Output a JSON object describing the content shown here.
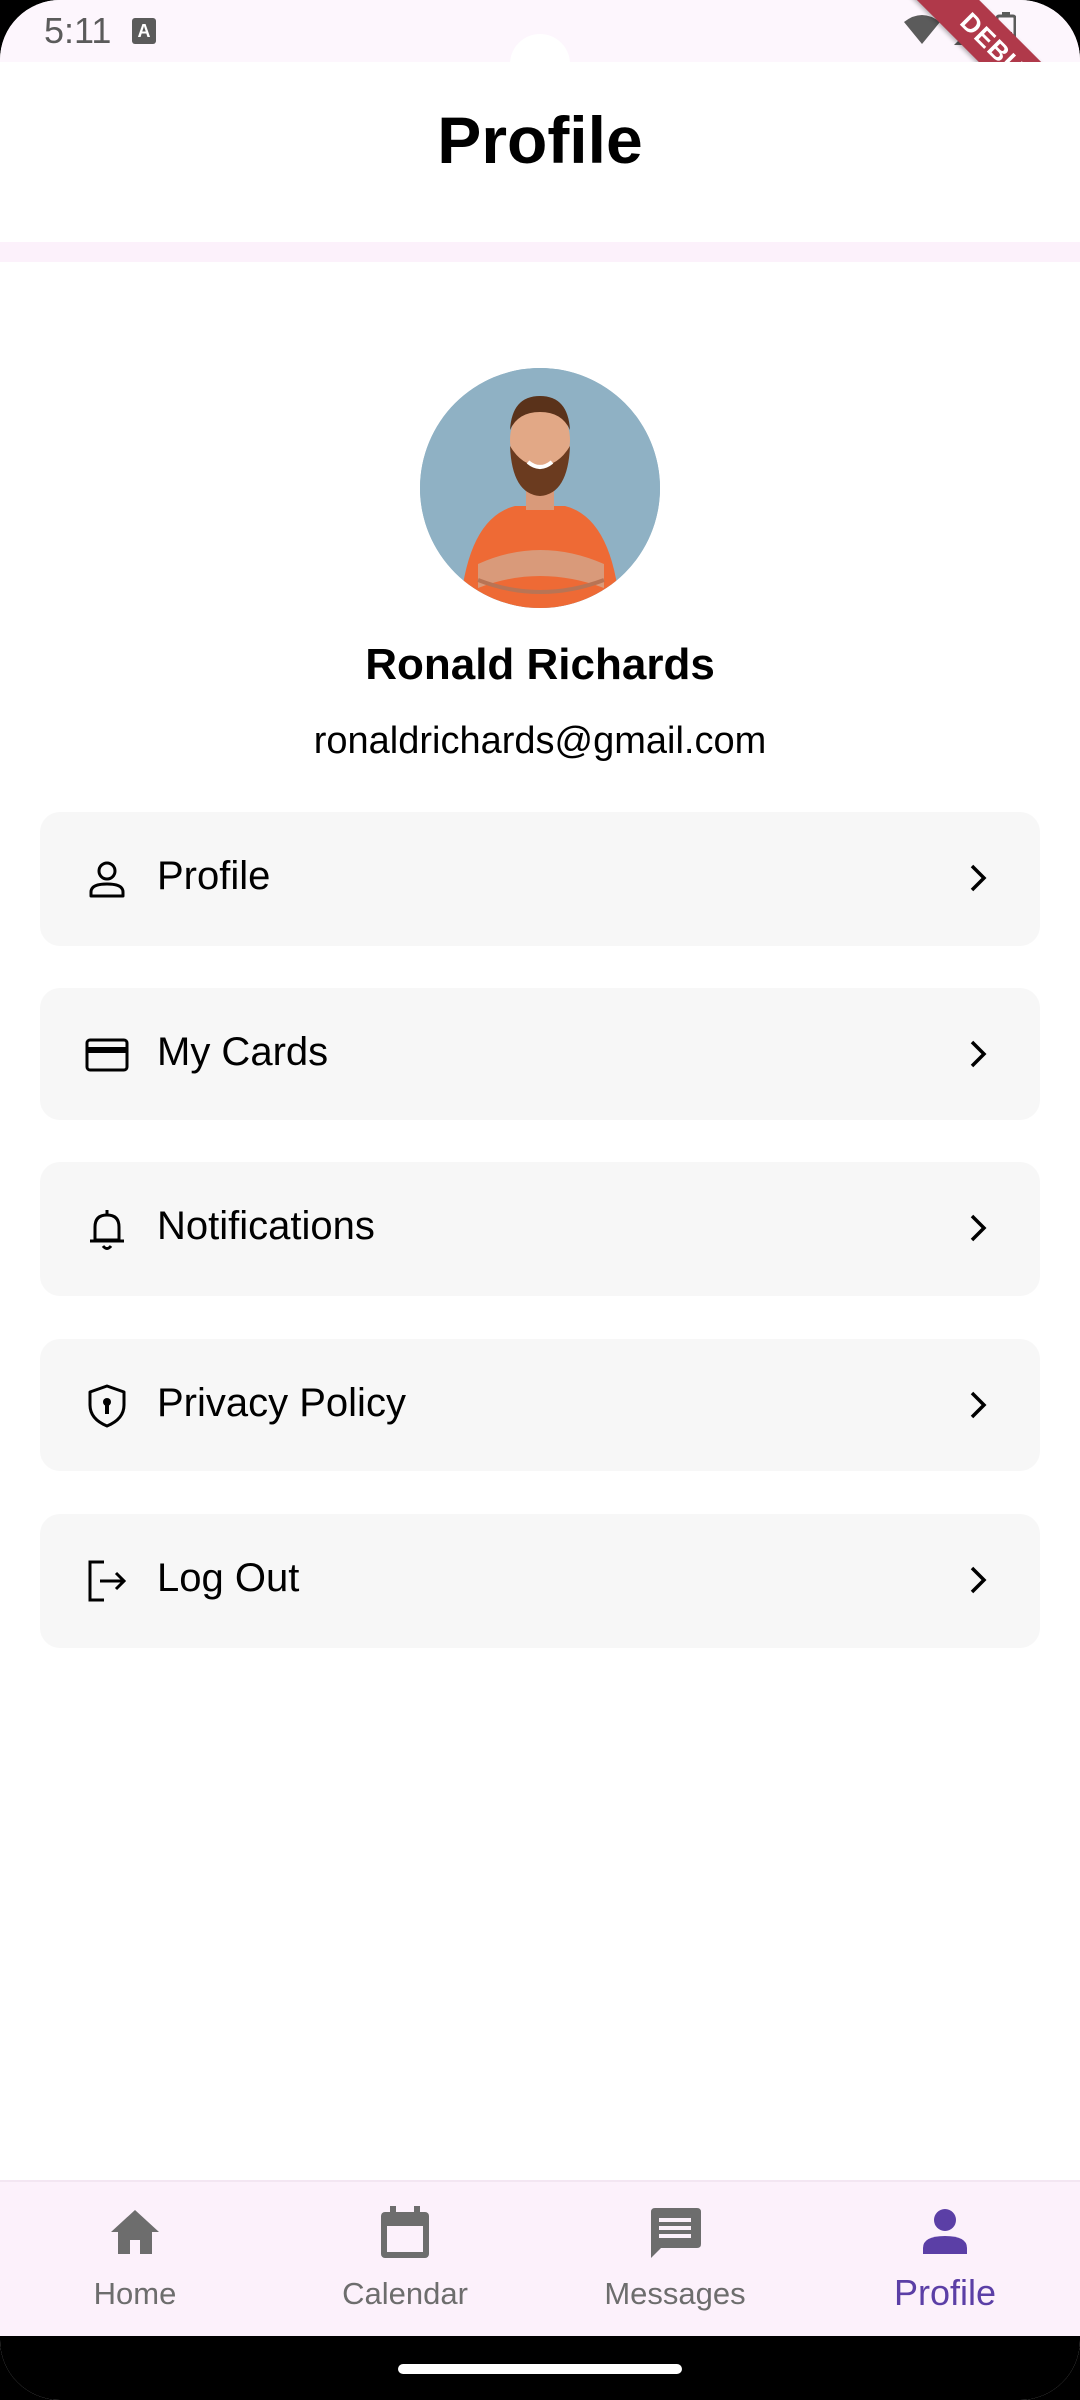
{
  "status_bar": {
    "time": "5:11",
    "a_icon_label": "A"
  },
  "debug_banner": "DEBUG",
  "header": {
    "title": "Profile"
  },
  "user": {
    "name": "Ronald Richards",
    "email": "ronaldrichards@gmail.com",
    "avatar_icon": "person-photo"
  },
  "menu": {
    "items": [
      {
        "label": "Profile",
        "icon": "person-outline-icon"
      },
      {
        "label": "My Cards",
        "icon": "credit-card-icon"
      },
      {
        "label": "Notifications",
        "icon": "bell-icon"
      },
      {
        "label": "Privacy Policy",
        "icon": "shield-keyhole-icon"
      },
      {
        "label": "Log Out",
        "icon": "logout-icon"
      }
    ]
  },
  "bottom_nav": {
    "items": [
      {
        "label": "Home",
        "icon": "home-icon",
        "active": false
      },
      {
        "label": "Calendar",
        "icon": "calendar-icon",
        "active": false
      },
      {
        "label": "Messages",
        "icon": "message-icon",
        "active": false
      },
      {
        "label": "Profile",
        "icon": "person-icon",
        "active": true
      }
    ]
  },
  "colors": {
    "accent": "#5b3fa6",
    "nav_background": "#fcf1fb",
    "menu_background": "#f7f7f7",
    "inactive": "#6d6d6d"
  }
}
